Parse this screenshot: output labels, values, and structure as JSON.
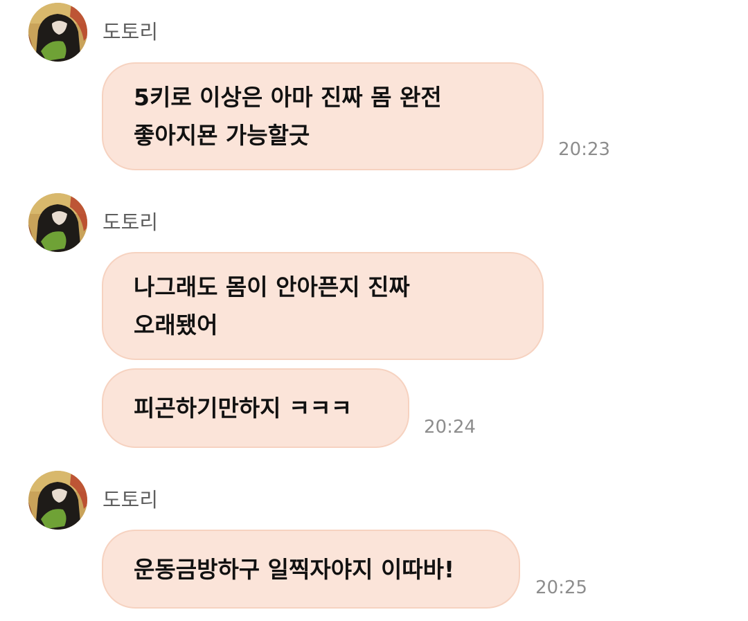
{
  "colors": {
    "bubble_bg": "#fbe4d9",
    "bubble_border": "#f6d2c0",
    "sender_text": "#5e5e5e",
    "time_text": "#8d8d8d"
  },
  "message_groups": [
    {
      "sender": "도토리",
      "avatar_icon": "profile-photo",
      "messages": [
        {
          "lines": [
            "5키로 이상은 아마 진짜 몸 완전",
            "좋아지묜 가능할긋"
          ],
          "time": "20:23"
        }
      ]
    },
    {
      "sender": "도토리",
      "avatar_icon": "profile-photo",
      "messages": [
        {
          "lines": [
            "나그래도 몸이 안아픈지 진짜",
            "오래됐어"
          ],
          "time": ""
        },
        {
          "lines": [
            "피곤하기만하지 ㅋㅋㅋ"
          ],
          "time": "20:24"
        }
      ]
    },
    {
      "sender": "도토리",
      "avatar_icon": "profile-photo",
      "messages": [
        {
          "lines": [
            "운동금방하구 일찍자야지 이따바!"
          ],
          "time": "20:25"
        }
      ]
    }
  ]
}
